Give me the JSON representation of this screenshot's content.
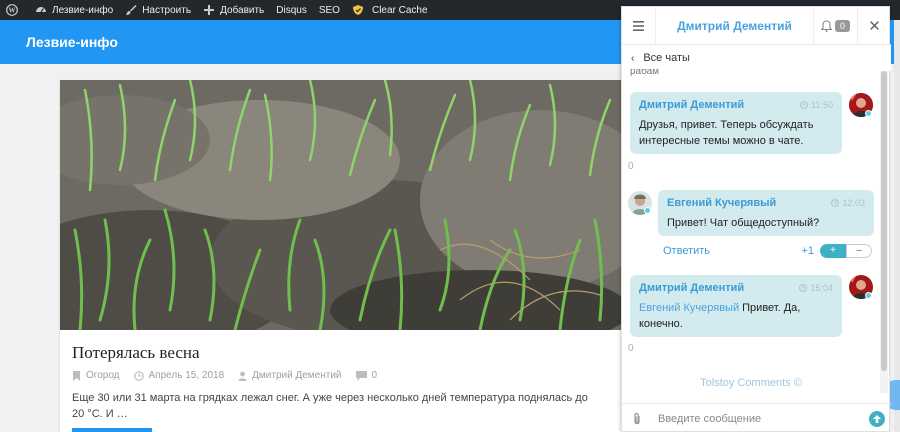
{
  "adminbar": {
    "items": [
      {
        "label": "",
        "icon": "wordpress-icon"
      },
      {
        "label": "Лезвие-инфо",
        "icon": "dashboard-icon"
      },
      {
        "label": "Настроить",
        "icon": "brush-icon"
      },
      {
        "label": "Добавить",
        "icon": "plus-icon"
      },
      {
        "label": "Disqus",
        "icon": ""
      },
      {
        "label": "SEO",
        "icon": ""
      },
      {
        "label": "Clear Cache",
        "icon": "shield-icon"
      }
    ]
  },
  "site": {
    "title": "Лезвие-инфо",
    "accent": "#2196f3"
  },
  "post": {
    "title": "Потерялась весна",
    "category": "Огород",
    "date": "Апрель 15, 2018",
    "author": "Дмитрий Дементий",
    "comments": "0",
    "excerpt": "Еще 30 или 31 марта на грядках лежал снег. А уже через несколько дней температура поднялась до 20 °С. И …"
  },
  "chat": {
    "header_user": "Дмитрий Дементий",
    "notifications": "0",
    "back_label": "Все чаты",
    "cut_text": "рабам",
    "messages": [
      {
        "author": "Дмитрий Дементий",
        "time": "11:50",
        "text": "Друзья, привет. Теперь обсуждать интересные темы можно в чате.",
        "zero": "0"
      },
      {
        "author": "Евгений Кучерявый",
        "time": "12:03",
        "text": "Привет! Чат общедоступный?",
        "reply": "Ответить",
        "score": "+1",
        "plus": "+",
        "minus": "–"
      },
      {
        "author": "Дмитрий Дементий",
        "time": "15:04",
        "mention": "Евгений Кучерявый",
        "text": " Привет. Да, конечно.",
        "zero": "0"
      }
    ],
    "footer": "Tolstoy Comments ©",
    "input_placeholder": "Введите сообщение"
  }
}
